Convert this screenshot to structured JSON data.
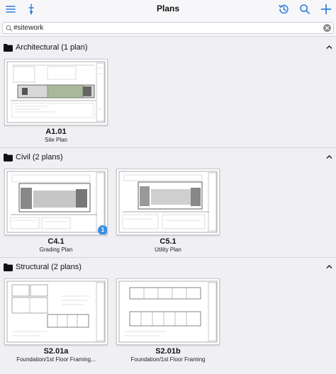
{
  "header": {
    "title": "Plans",
    "accent_color": "#2d7be0"
  },
  "search": {
    "value": "#sitework",
    "placeholder": ""
  },
  "sections": [
    {
      "label": "Architectural (1 plan)",
      "plans": [
        {
          "number": "A1.01",
          "name": "Site Plan"
        }
      ]
    },
    {
      "label": "Civil (2 plans)",
      "plans": [
        {
          "number": "C4.1",
          "name": "Grading Plan",
          "badge": "1"
        },
        {
          "number": "C5.1",
          "name": "Utility Plan"
        }
      ]
    },
    {
      "label": "Structural (2 plans)",
      "plans": [
        {
          "number": "S2.01a",
          "name": "Foundation/1st Floor Framing..."
        },
        {
          "number": "S2.01b",
          "name": "Foundation/1st Floor Framing"
        }
      ]
    }
  ],
  "icons": {
    "menu": "menu-icon",
    "pen": "markup-pen-icon",
    "history": "history-icon",
    "search": "search-icon",
    "add": "plus-icon",
    "clear": "clear-search-icon",
    "folder": "folder-icon",
    "collapse": "chevron-up-icon"
  }
}
